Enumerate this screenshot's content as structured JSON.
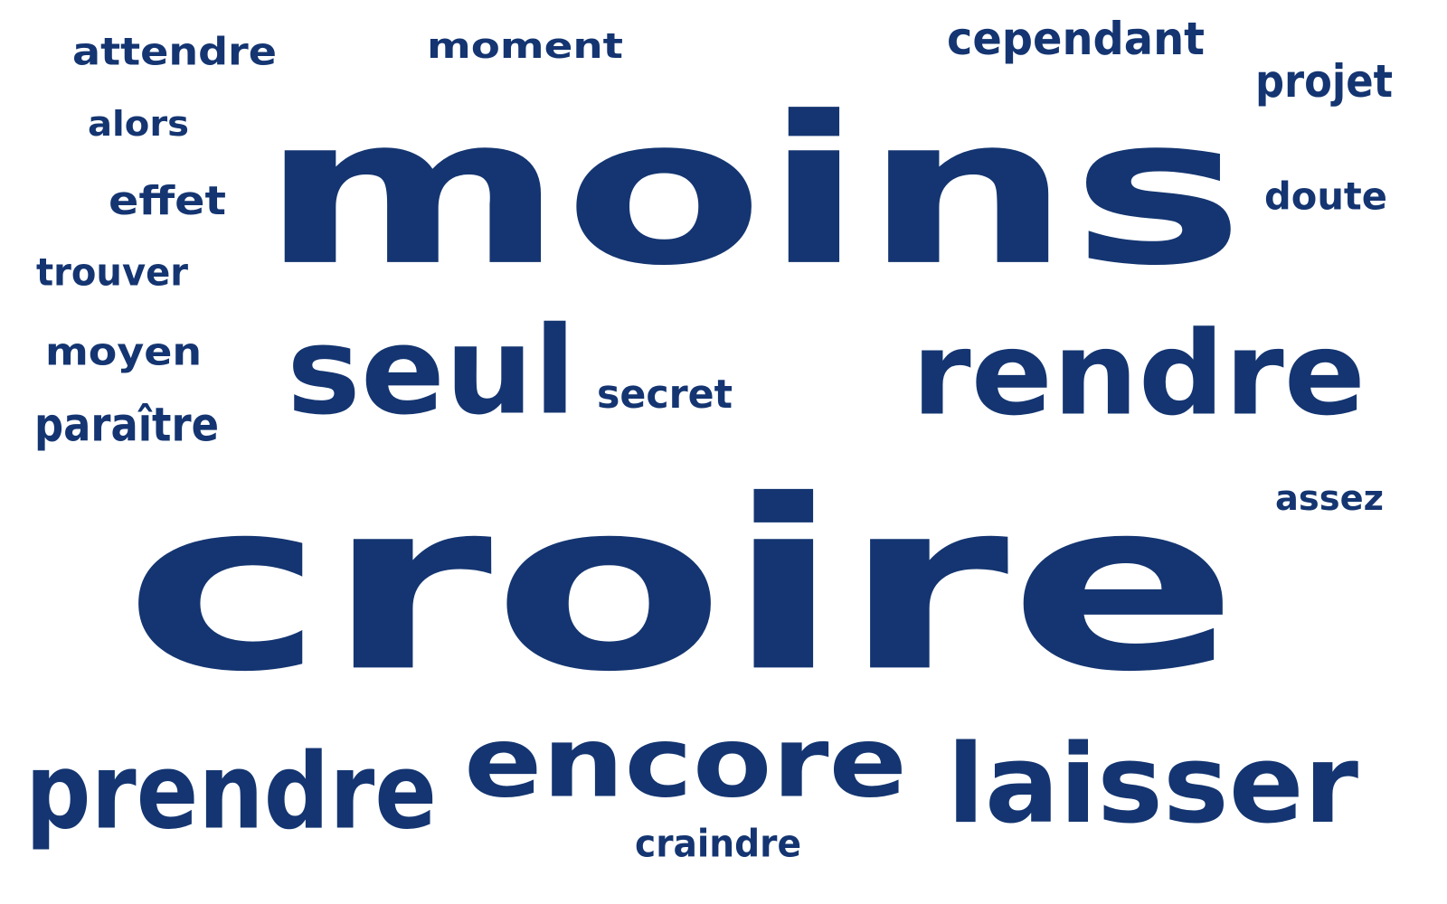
{
  "word_cloud": {
    "text_color": "#143571",
    "background_color": "#ffffff",
    "words": [
      {
        "key": "croire",
        "text": "croire"
      },
      {
        "key": "moins",
        "text": "moins"
      },
      {
        "key": "rendre",
        "text": "rendre"
      },
      {
        "key": "seul",
        "text": "seul"
      },
      {
        "key": "laisser",
        "text": "laisser"
      },
      {
        "key": "encore",
        "text": "encore"
      },
      {
        "key": "prendre",
        "text": "prendre"
      },
      {
        "key": "secret",
        "text": "secret"
      },
      {
        "key": "attendre",
        "text": "attendre"
      },
      {
        "key": "moment",
        "text": "moment"
      },
      {
        "key": "cependant",
        "text": "cependant"
      },
      {
        "key": "projet",
        "text": "projet"
      },
      {
        "key": "alors",
        "text": "alors"
      },
      {
        "key": "effet",
        "text": "effet"
      },
      {
        "key": "doute",
        "text": "doute"
      },
      {
        "key": "trouver",
        "text": "trouver"
      },
      {
        "key": "moyen",
        "text": "moyen"
      },
      {
        "key": "paraitre",
        "text": "paraître"
      },
      {
        "key": "assez",
        "text": "assez"
      },
      {
        "key": "craindre",
        "text": "craindre"
      }
    ]
  }
}
